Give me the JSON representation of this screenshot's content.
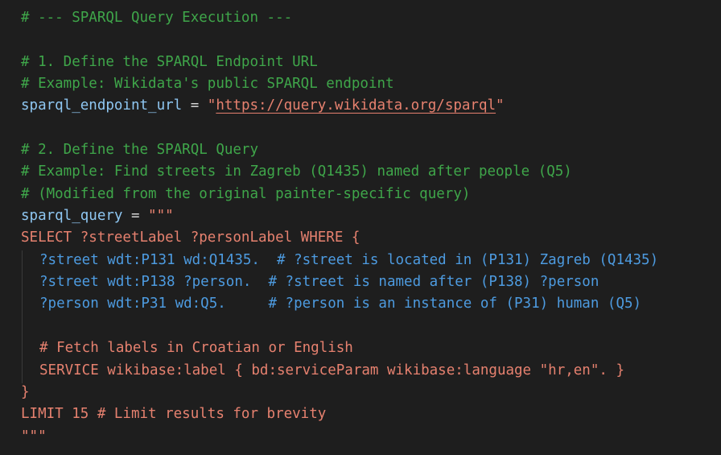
{
  "code": {
    "l1": "# --- SPARQL Query Execution ---",
    "l3": "# 1. Define the SPARQL Endpoint URL",
    "l4": "# Example: Wikidata's public SPARQL endpoint",
    "l5_var": "sparql_endpoint_url",
    "l5_op": " = ",
    "l5_q1": "\"",
    "l5_url": "https://query.wikidata.org/sparql",
    "l5_q2": "\"",
    "l7": "# 2. Define the SPARQL Query",
    "l8": "# Example: Find streets in Zagreb (Q1435) named after people (Q5)",
    "l9": "# (Modified from the original painter-specific query)",
    "l10_var": "sparql_query",
    "l10_op": " = ",
    "l10_str": "\"\"\"",
    "l11": "SELECT ?streetLabel ?personLabel WHERE {",
    "l12": "?street wdt:P131 wd:Q1435.  # ?street is located in (P131) Zagreb (Q1435)",
    "l13": "?street wdt:P138 ?person.  # ?street is named after (P138) ?person",
    "l14": "?person wdt:P31 wd:Q5.     # ?person is an instance of (P31) human (Q5)",
    "l16": "# Fetch labels in Croatian or English",
    "l17": "SERVICE wikibase:label { bd:serviceParam wikibase:language \"hr,en\". }",
    "l18": "}",
    "l19": "LIMIT 15 # Limit results for brevity",
    "l20": "\"\"\""
  },
  "colors": {
    "background": "#1e1e1e",
    "comment": "#3fa64a",
    "variable": "#8fc7f2",
    "string": "#e6816f",
    "sparql_body": "#4d9be0"
  }
}
